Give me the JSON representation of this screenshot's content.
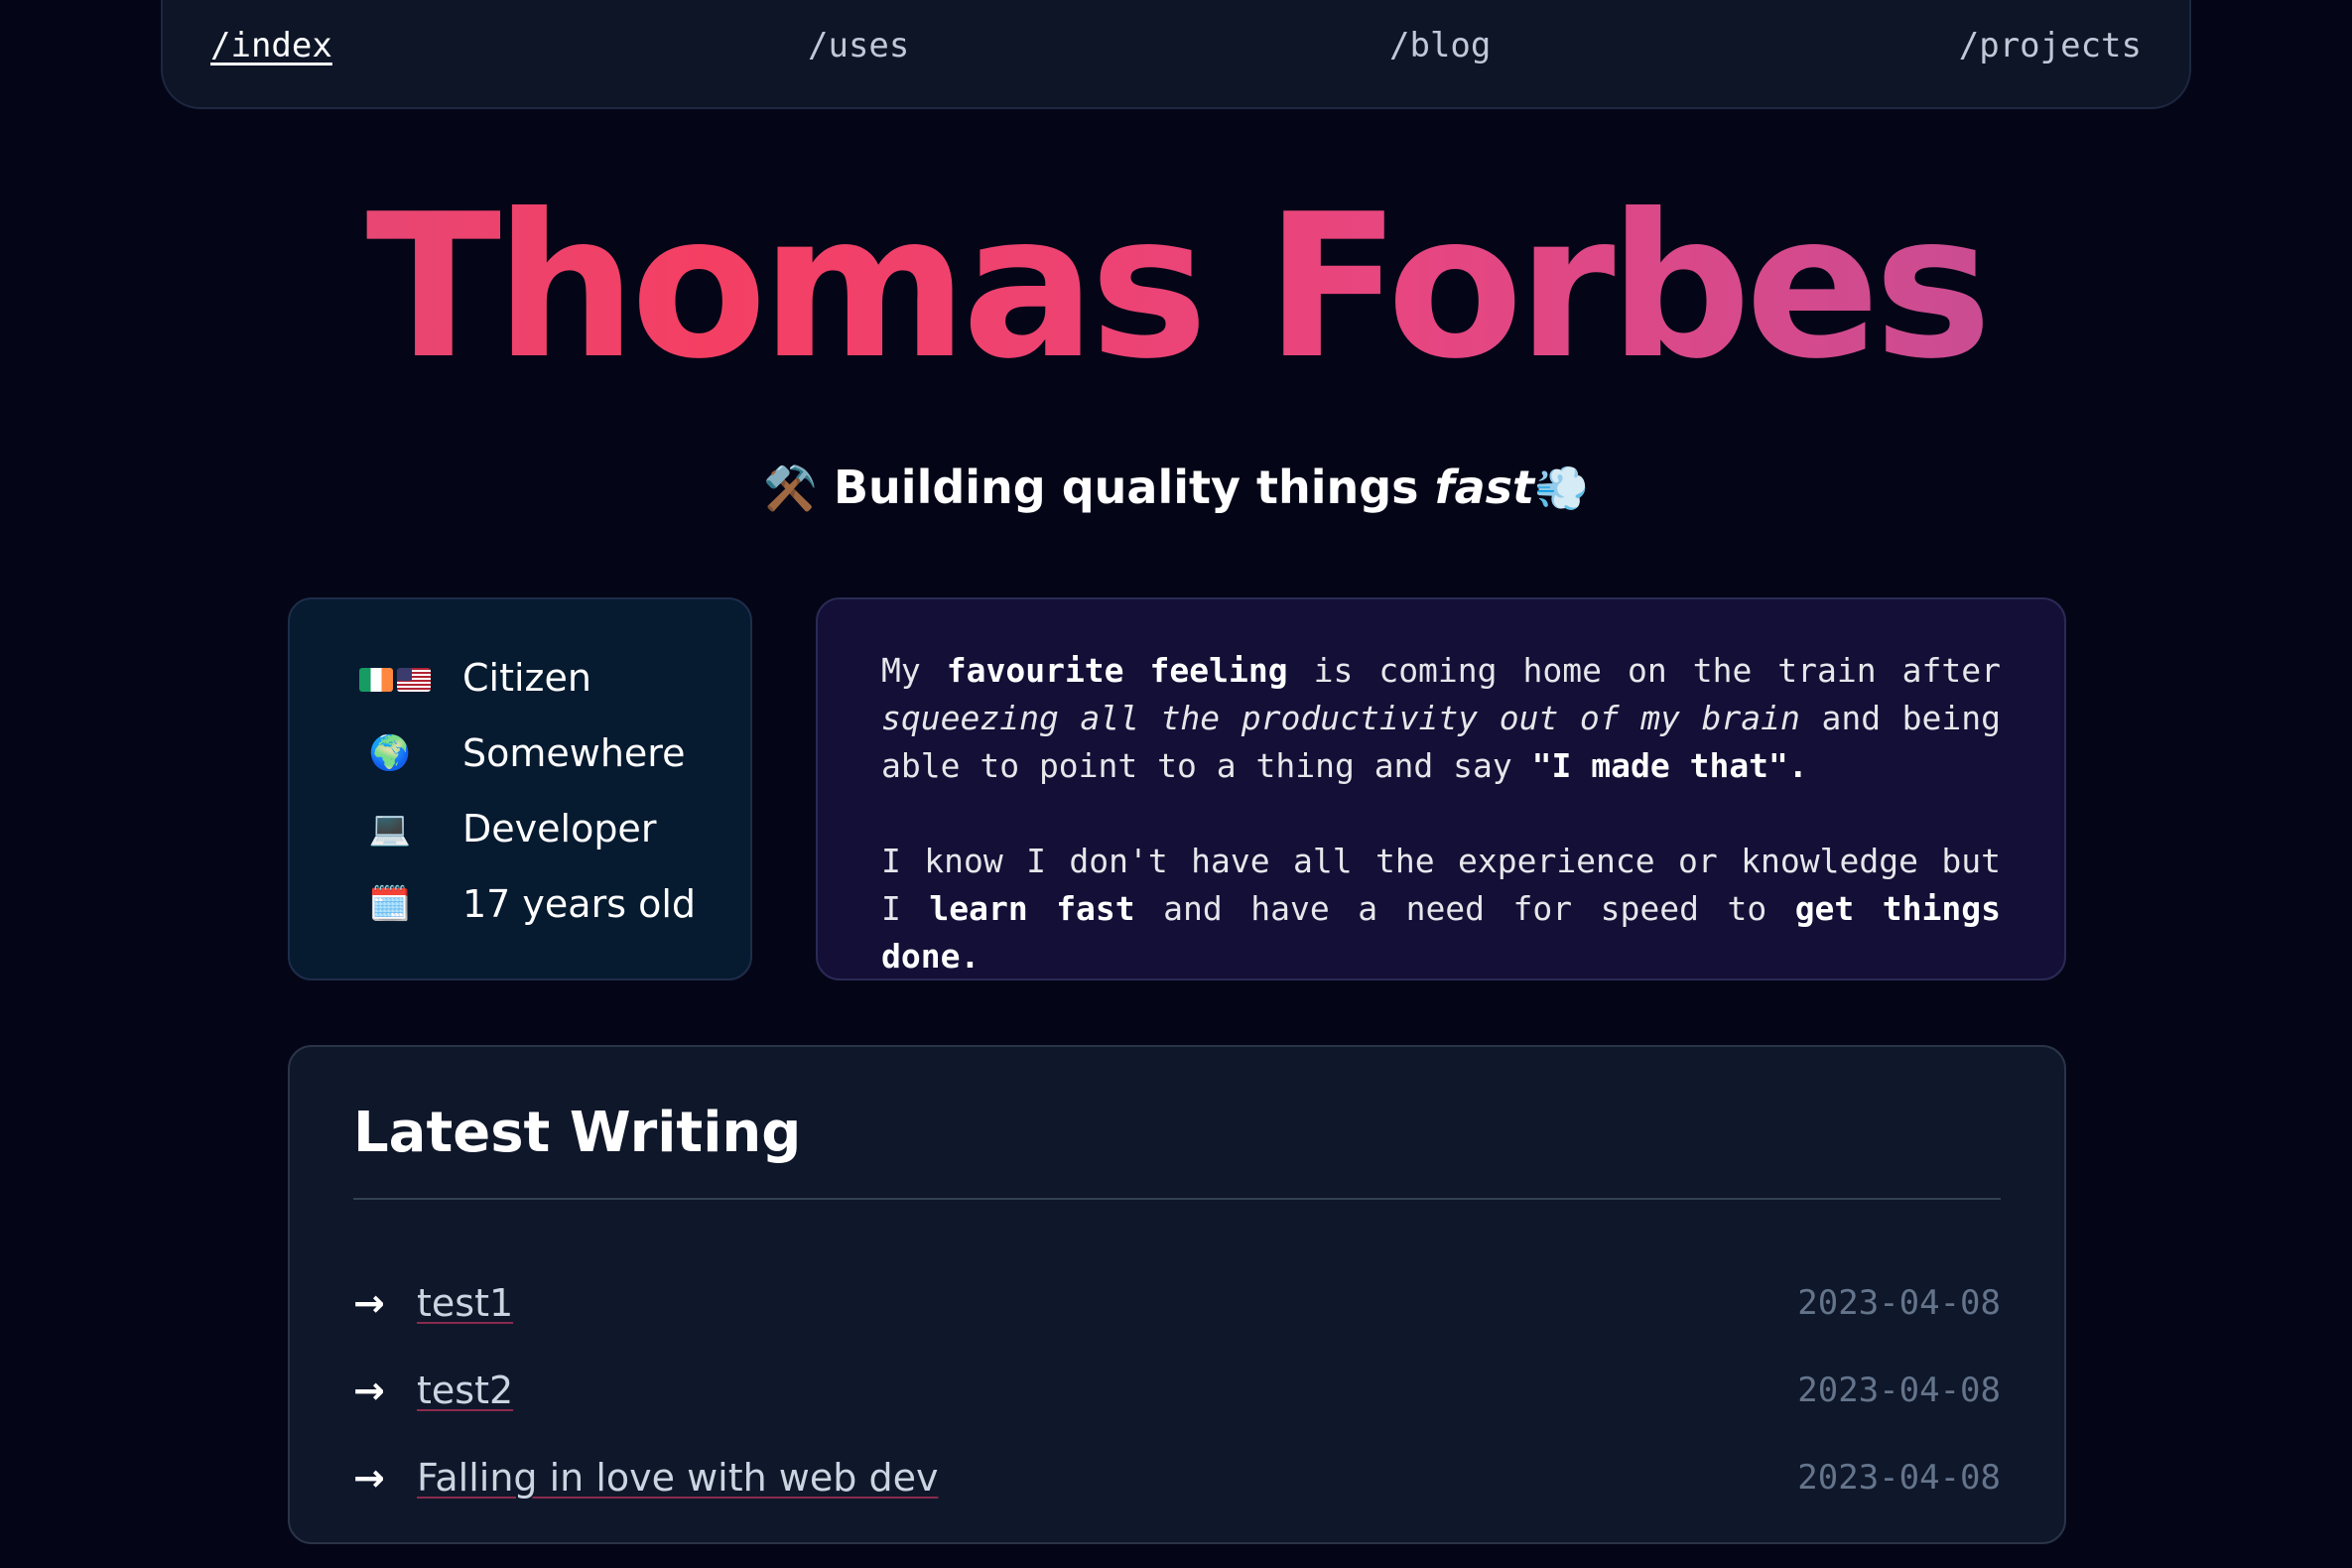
{
  "nav": {
    "items": [
      {
        "label": "/index",
        "active": true
      },
      {
        "label": "/uses",
        "active": false
      },
      {
        "label": "/blog",
        "active": false
      },
      {
        "label": "/projects",
        "active": false
      }
    ]
  },
  "hero": {
    "name": "Thomas Forbes",
    "gradient_colors": [
      "#db4d85",
      "#f43f63",
      "#e74680",
      "#b9509f"
    ],
    "tagline": {
      "leading_emoji": "⚒️",
      "text": "Building quality things",
      "emphasis": "fast",
      "trailing_emoji": "💨"
    }
  },
  "info": {
    "items": [
      {
        "icon": "ireland-usa-flags-icon",
        "label": "Citizen"
      },
      {
        "icon": "globe-icon",
        "glyph": "🌍",
        "label": "Somewhere"
      },
      {
        "icon": "laptop-icon",
        "glyph": "💻",
        "label": "Developer"
      },
      {
        "icon": "calendar-icon",
        "glyph": "🗓️",
        "label": "17 years old"
      }
    ]
  },
  "about": {
    "p1": {
      "t1": "My ",
      "b1": "favourite feeling",
      "t2": " is coming home on the train after ",
      "i1": "squeezing all the productivity out of my brain",
      "t3": " and being able to point to a thing and say ",
      "b2": "\"I made that\".",
      "t4": ""
    },
    "p2": {
      "t1": "I know I don't have all the experience or knowledge but I ",
      "b1": "learn fast",
      "t2": " and have a need for speed to ",
      "b2": "get things done."
    }
  },
  "writing": {
    "title": "Latest Writing",
    "arrow": "→",
    "posts": [
      {
        "title": "test1",
        "date": "2023-04-08"
      },
      {
        "title": "test2",
        "date": "2023-04-08"
      },
      {
        "title": "Falling in love with web dev",
        "date": "2023-04-08"
      }
    ]
  },
  "colors": {
    "background": "#040617",
    "nav_background": "#0d1527",
    "info_card_background": "#061a30",
    "quote_card_background": "#140f36",
    "writing_card_background": "#0f172a",
    "date_text": "#64748b",
    "link_underline": "#8a2b4d"
  }
}
